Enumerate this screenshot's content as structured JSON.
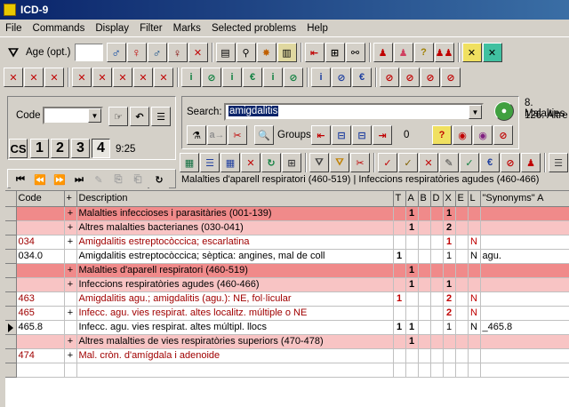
{
  "window": {
    "title": "ICD-9"
  },
  "menu": [
    {
      "label": "File"
    },
    {
      "label": "Commands"
    },
    {
      "label": "Display"
    },
    {
      "label": "Filter"
    },
    {
      "label": "Marks"
    },
    {
      "label": "Selected problems"
    },
    {
      "label": "Help"
    }
  ],
  "toolbar1": {
    "age_label": "Age (opt.)",
    "age_value": ""
  },
  "code_panel": {
    "code_label": "Code",
    "code_value": "",
    "time": "9:25",
    "cs_label": "CS",
    "levels": [
      "1",
      "2",
      "3",
      "4"
    ],
    "active_level": "4"
  },
  "search_panel": {
    "search_label": "Search:",
    "search_value": "amigdalitis",
    "groups_label": "Groups",
    "groups_count": "0"
  },
  "right_info": {
    "line1": "8. Malalties",
    "line2": "126. Altre"
  },
  "breadcrumb": "Malalties d'aparell respiratori (460-519) | Infeccions respiratòries agudes (460-466)",
  "grid": {
    "headers": {
      "code": "Code",
      "plus": "+",
      "desc": "Description",
      "t": "T",
      "a": "A",
      "b": "B",
      "d": "D",
      "x": "X",
      "e": "E",
      "l": "L",
      "syn": "\"Synonyms\" A"
    },
    "rows": [
      {
        "style": "h1",
        "code": "",
        "plus": "+",
        "desc": "Malalties infeccioses i parasitàries (001-139)",
        "t": "",
        "a": "1",
        "b": "",
        "d": "",
        "x": "1",
        "e": "",
        "l": "",
        "syn": ""
      },
      {
        "style": "h2",
        "code": "",
        "plus": "+",
        "desc": "Altres malalties bacterianes (030-041)",
        "t": "",
        "a": "1",
        "b": "",
        "d": "",
        "x": "2",
        "e": "",
        "l": "",
        "syn": ""
      },
      {
        "style": "red",
        "code": "034",
        "plus": "+",
        "desc": "Amigdalitis estreptocòccica; escarlatina",
        "t": "",
        "a": "",
        "b": "",
        "d": "",
        "x": "1",
        "e": "",
        "l": "N",
        "syn": ""
      },
      {
        "style": "plain",
        "code": "034.0",
        "plus": "",
        "desc": "Amigdalitis estreptocòccica; sèptica: angines, mal de coll",
        "t": "1",
        "a": "",
        "b": "",
        "d": "",
        "x": "1",
        "e": "",
        "l": "N",
        "syn": "agu."
      },
      {
        "style": "h1",
        "code": "",
        "plus": "+",
        "desc": "Malalties d'aparell respiratori (460-519)",
        "t": "",
        "a": "1",
        "b": "",
        "d": "",
        "x": "",
        "e": "",
        "l": "",
        "syn": ""
      },
      {
        "style": "h2",
        "code": "",
        "plus": "+",
        "desc": "Infeccions respiratòries agudes (460-466)",
        "t": "",
        "a": "1",
        "b": "",
        "d": "",
        "x": "1",
        "e": "",
        "l": "",
        "syn": ""
      },
      {
        "style": "red",
        "code": "463",
        "plus": "",
        "desc": "Amigdalitis agu.; amigdalitis (agu.): NE, fol·licular",
        "t": "1",
        "a": "",
        "b": "",
        "d": "",
        "x": "2",
        "e": "",
        "l": "N",
        "syn": ""
      },
      {
        "style": "red",
        "code": "465",
        "plus": "+",
        "desc": "Infecc. agu. vies respirat. altes localitz. múltiple o NE",
        "t": "",
        "a": "",
        "b": "",
        "d": "",
        "x": "2",
        "e": "",
        "l": "N",
        "syn": ""
      },
      {
        "style": "plain",
        "current": true,
        "code": "465.8",
        "plus": "",
        "desc": "Infecc. agu. vies respirat. altes múltipl. llocs",
        "t": "1",
        "a": "1",
        "b": "",
        "d": "",
        "x": "1",
        "e": "",
        "l": "N",
        "syn": "_465.8"
      },
      {
        "style": "h2",
        "code": "",
        "plus": "+",
        "desc": "Altres malalties de vies respiratòries superiors (470-478)",
        "t": "",
        "a": "1",
        "b": "",
        "d": "",
        "x": "",
        "e": "",
        "l": "",
        "syn": ""
      },
      {
        "style": "red",
        "code": "474",
        "plus": "+",
        "desc": "Mal. cròn. d'amígdala i adenoide",
        "t": "",
        "a": "",
        "b": "",
        "d": "",
        "x": "",
        "e": "",
        "l": "",
        "syn": ""
      },
      {
        "style": "plain",
        "code": "",
        "plus": "",
        "desc": "",
        "t": "",
        "a": "",
        "b": "",
        "d": "",
        "x": "",
        "e": "",
        "l": "",
        "syn": ""
      }
    ]
  },
  "colors": {
    "title_bar": "#0a246a",
    "header_row": "#f08a8a",
    "subheader_row": "#f8c4c4",
    "code_text": "#a00000",
    "search_highlight": "#0a246a"
  }
}
